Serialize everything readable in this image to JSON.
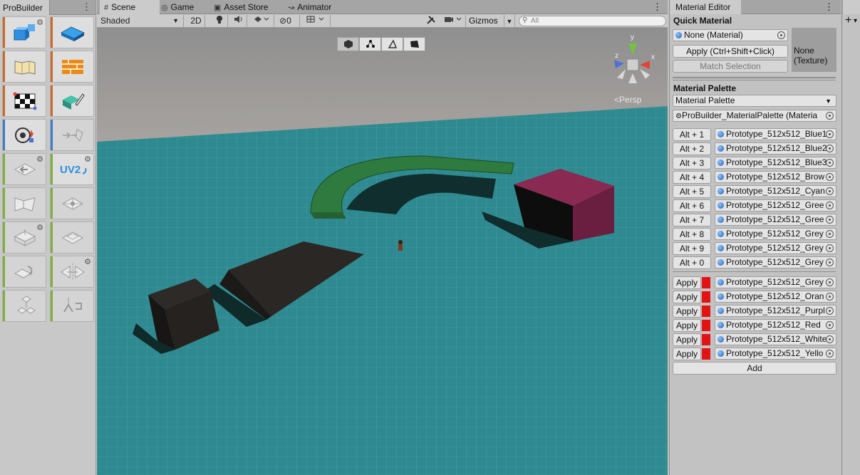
{
  "probuilder": {
    "tab_title": "ProBuilder",
    "menu_glyph": "⋮",
    "gear_glyph": "⚙",
    "tools": [
      {
        "name": "new-shape-icon",
        "strip": "#c9692c",
        "gear": true,
        "dim": false
      },
      {
        "name": "poly-shape-icon",
        "strip": "#c9692c",
        "gear": false,
        "dim": false
      },
      {
        "name": "smooth-groups-icon",
        "strip": "#c9692c",
        "gear": false,
        "dim": false
      },
      {
        "name": "material-editor-icon",
        "strip": "#c9692c",
        "gear": false,
        "dim": false
      },
      {
        "name": "uv-editor-icon",
        "strip": "#c9692c",
        "gear": false,
        "dim": false
      },
      {
        "name": "vertex-colors-icon",
        "strip": "#c9692c",
        "gear": false,
        "dim": false
      },
      {
        "name": "selection-tools-icon",
        "strip": "#3a7cc6",
        "gear": false,
        "dim": false
      },
      {
        "name": "grow-selection-icon",
        "strip": "#3a7cc6",
        "gear": false,
        "dim": true
      },
      {
        "name": "shrink-selection-icon",
        "strip": "#7fae3b",
        "gear": true,
        "dim": true
      },
      {
        "name": "lightmap-uvs-icon",
        "strip": "#7fae3b",
        "gear": true,
        "dim": false
      },
      {
        "name": "triangulate-icon",
        "strip": "#7fae3b",
        "gear": false,
        "dim": true
      },
      {
        "name": "center-pivot-icon",
        "strip": "#7fae3b",
        "gear": false,
        "dim": true
      },
      {
        "name": "conform-normals-icon",
        "strip": "#7fae3b",
        "gear": true,
        "dim": true
      },
      {
        "name": "export-icon",
        "strip": "#7fae3b",
        "gear": false,
        "dim": true
      },
      {
        "name": "flip-normals-icon",
        "strip": "#7fae3b",
        "gear": false,
        "dim": true
      },
      {
        "name": "mirror-objects-icon",
        "strip": "#7fae3b",
        "gear": true,
        "dim": true
      },
      {
        "name": "merge-objects-icon",
        "strip": "#7fae3b",
        "gear": false,
        "dim": true
      },
      {
        "name": "set-pivot-icon",
        "strip": "#7fae3b",
        "gear": false,
        "dim": true
      }
    ],
    "uv2_label": "UV2"
  },
  "scene": {
    "tabs": [
      {
        "label": "Scene",
        "icon": "#"
      },
      {
        "label": "Game",
        "icon": "◎"
      },
      {
        "label": "Asset Store",
        "icon": "▣"
      },
      {
        "label": "Animator",
        "icon": "↝"
      }
    ],
    "menu_glyph": "⋮",
    "toolbar": {
      "shading_mode": "Shaded",
      "two_d": "2D",
      "hidden_count": "0",
      "gizmos": "Gizmos",
      "search_placeholder": "All"
    },
    "projection_label": "Persp",
    "axis_labels": {
      "x": "x",
      "y": "y",
      "z": "z"
    }
  },
  "material_editor": {
    "tab_title": "Material Editor",
    "menu_glyph": "⋮",
    "quick_material_title": "Quick Material",
    "quick_material_field": "None (Material)",
    "apply_button": "Apply (Ctrl+Shift+Click)",
    "match_selection_button": "Match Selection",
    "texture_preview": "None (Texture)",
    "palette_title": "Material Palette",
    "palette_dropdown": "Material Palette",
    "palette_asset": "ProBuilder_MaterialPalette (Materia",
    "shortcut_rows": [
      {
        "shortcut": "Alt + 1",
        "material": "Prototype_512x512_Blue1"
      },
      {
        "shortcut": "Alt + 2",
        "material": "Prototype_512x512_Blue2"
      },
      {
        "shortcut": "Alt + 3",
        "material": "Prototype_512x512_Blue3"
      },
      {
        "shortcut": "Alt + 4",
        "material": "Prototype_512x512_Brow"
      },
      {
        "shortcut": "Alt + 5",
        "material": "Prototype_512x512_Cyan"
      },
      {
        "shortcut": "Alt + 6",
        "material": "Prototype_512x512_Gree"
      },
      {
        "shortcut": "Alt + 7",
        "material": "Prototype_512x512_Gree"
      },
      {
        "shortcut": "Alt + 8",
        "material": "Prototype_512x512_Grey"
      },
      {
        "shortcut": "Alt + 9",
        "material": "Prototype_512x512_Grey"
      },
      {
        "shortcut": "Alt + 0",
        "material": "Prototype_512x512_Grey"
      }
    ],
    "apply_rows": [
      {
        "label": "Apply",
        "material": "Prototype_512x512_Grey"
      },
      {
        "label": "Apply",
        "material": "Prototype_512x512_Oran"
      },
      {
        "label": "Apply",
        "material": "Prototype_512x512_Purpl"
      },
      {
        "label": "Apply",
        "material": "Prototype_512x512_Red"
      },
      {
        "label": "Apply",
        "material": "Prototype_512x512_White"
      },
      {
        "label": "Apply",
        "material": "Prototype_512x512_Yello"
      }
    ],
    "add_button": "Add"
  },
  "right_panel": {
    "plus": "+",
    "chevron": "▾"
  },
  "colors": {
    "accent_red": "#e41313",
    "ground": "#2e8a90",
    "sky": "#a9a9a9"
  }
}
